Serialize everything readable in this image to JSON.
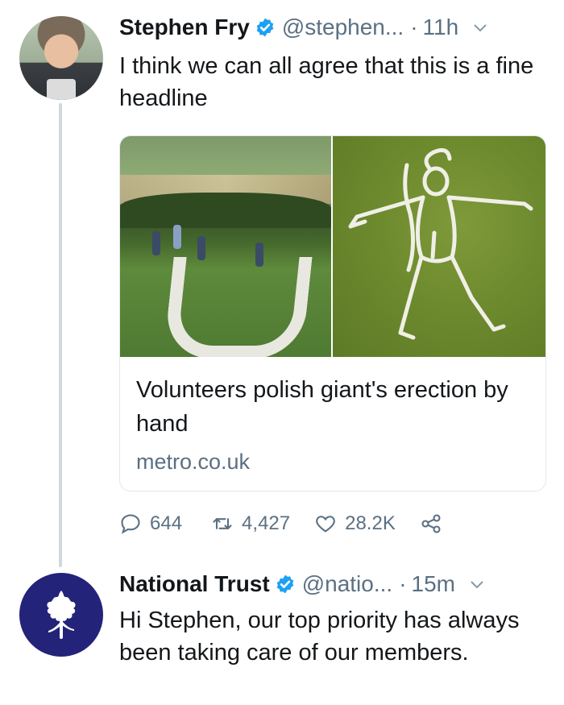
{
  "tweets": [
    {
      "author": "Stephen Fry",
      "handle": "@stephen...",
      "time": "11h",
      "text": "I think we can all agree that this is a fine headline",
      "card": {
        "title": "Volunteers polish giant's erection by hand",
        "domain": "metro.co.uk"
      },
      "stats": {
        "replies": "644",
        "retweets": "4,427",
        "likes": "28.2K"
      }
    },
    {
      "author": "National Trust",
      "handle": "@natio...",
      "time": "15m",
      "text": "Hi Stephen, our top priority has always been taking care of our members."
    }
  ],
  "icons": {
    "verified": "verified-badge-icon",
    "chevron": "chevron-down-icon",
    "reply": "reply-icon",
    "retweet": "retweet-icon",
    "like": "heart-icon",
    "share": "share-icon"
  },
  "colors": {
    "verified_blue": "#1da1f2",
    "secondary_text": "#5b7083",
    "thread_line": "#cfd9de",
    "national_trust_blue": "#23237a"
  }
}
